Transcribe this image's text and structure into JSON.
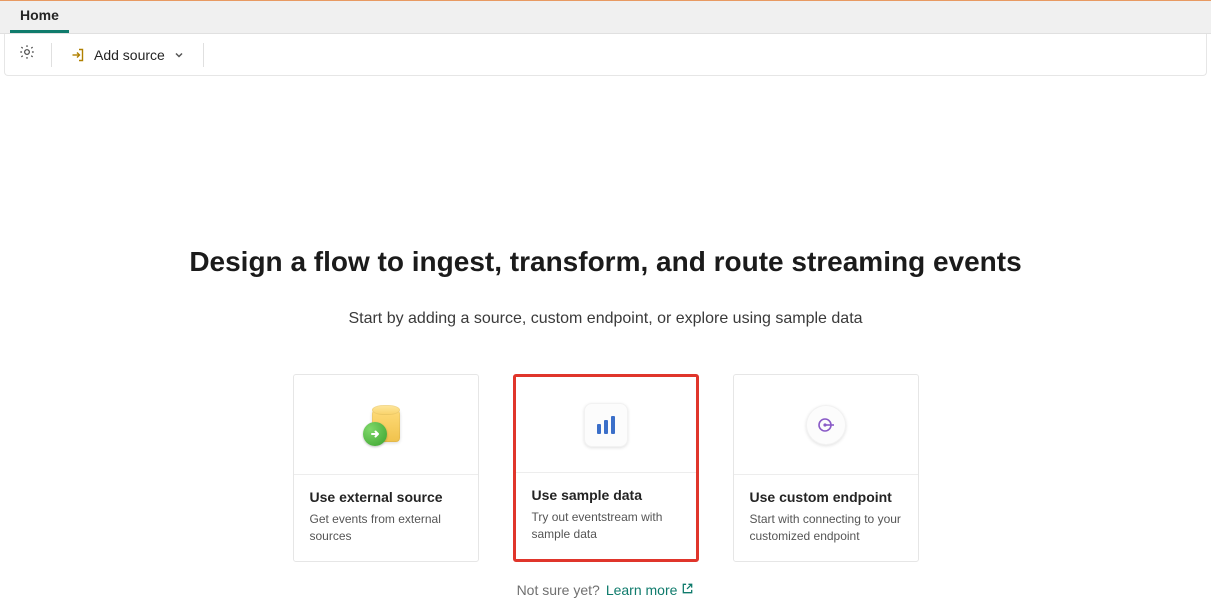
{
  "tabs": {
    "home": "Home"
  },
  "toolbar": {
    "add_source": "Add source"
  },
  "main": {
    "title": "Design a flow to ingest, transform, and route streaming events",
    "subtitle": "Start by adding a source, custom endpoint, or explore using sample data"
  },
  "cards": [
    {
      "title": "Use external source",
      "desc": "Get events from external sources",
      "highlight": false
    },
    {
      "title": "Use sample data",
      "desc": "Try out eventstream with sample data",
      "highlight": true
    },
    {
      "title": "Use custom endpoint",
      "desc": "Start with connecting to your customized endpoint",
      "highlight": false
    }
  ],
  "footer": {
    "not_sure": "Not sure yet?",
    "learn_more": "Learn more"
  }
}
